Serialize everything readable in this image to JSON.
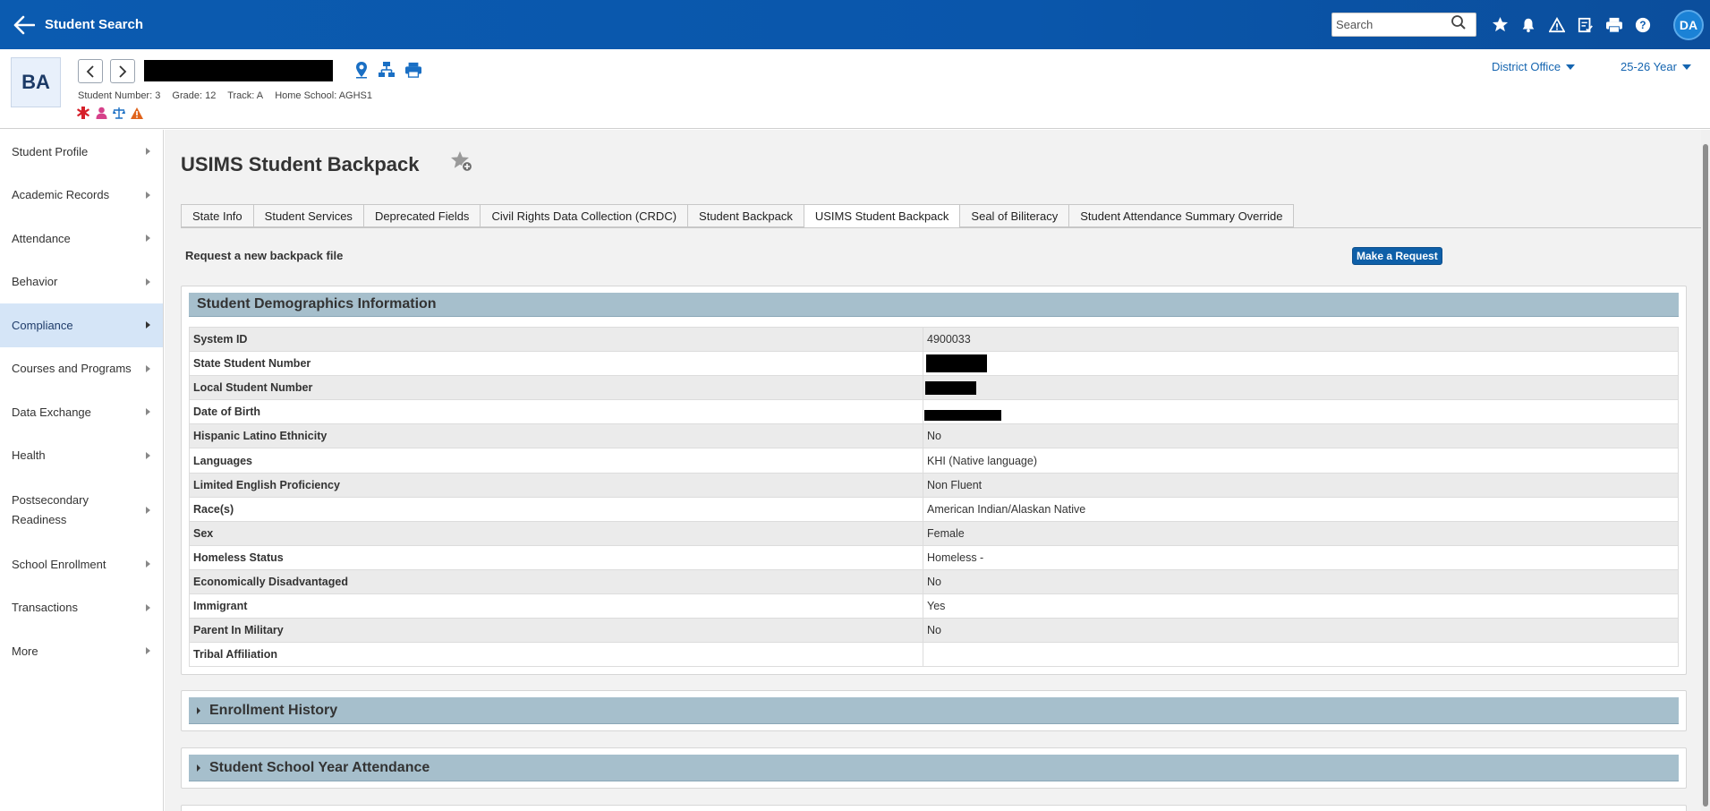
{
  "app": {
    "title": "Student Search"
  },
  "topbar": {
    "search_placeholder": "Search",
    "user_initials": "DA"
  },
  "student": {
    "initials": "BA",
    "number_label": "Student Number: 3",
    "grade_label": "Grade: 12",
    "track_label": "Track: A",
    "home_school_label": "Home School: AGHS1"
  },
  "context": {
    "office": "District Office",
    "year": "25-26 Year"
  },
  "sidebar": {
    "items": [
      {
        "label": "Student Profile"
      },
      {
        "label": "Academic Records"
      },
      {
        "label": "Attendance"
      },
      {
        "label": "Behavior"
      },
      {
        "label": "Compliance"
      },
      {
        "label": "Courses and Programs"
      },
      {
        "label": "Data Exchange"
      },
      {
        "label": "Health"
      },
      {
        "label": "Postsecondary Readiness"
      },
      {
        "label": "School Enrollment"
      },
      {
        "label": "Transactions"
      },
      {
        "label": "More"
      }
    ]
  },
  "page": {
    "title": "USIMS Student Backpack"
  },
  "tabs": [
    {
      "label": "State Info"
    },
    {
      "label": "Student Services"
    },
    {
      "label": "Deprecated Fields"
    },
    {
      "label": "Civil Rights Data Collection (CRDC)"
    },
    {
      "label": "Student Backpack"
    },
    {
      "label": "USIMS Student Backpack"
    },
    {
      "label": "Seal of Biliteracy"
    },
    {
      "label": "Student Attendance Summary Override"
    }
  ],
  "request": {
    "label": "Request a new backpack file",
    "button": "Make a Request"
  },
  "demographics": {
    "title": "Student Demographics Information",
    "rows": [
      {
        "key": "System ID",
        "value": "4900033"
      },
      {
        "key": "State Student Number",
        "value": ""
      },
      {
        "key": "Local Student Number",
        "value": ""
      },
      {
        "key": "Date of Birth",
        "value": ""
      },
      {
        "key": "Hispanic Latino Ethnicity",
        "value": "No"
      },
      {
        "key": "Languages",
        "value": "KHI (Native language)"
      },
      {
        "key": "Limited English Proficiency",
        "value": "Non Fluent"
      },
      {
        "key": "Race(s)",
        "value": "American Indian/Alaskan Native"
      },
      {
        "key": "Sex",
        "value": "Female"
      },
      {
        "key": "Homeless Status",
        "value": "Homeless -"
      },
      {
        "key": "Economically Disadvantaged",
        "value": "No"
      },
      {
        "key": "Immigrant",
        "value": "Yes"
      },
      {
        "key": "Parent In Military",
        "value": "No"
      },
      {
        "key": "Tribal Affiliation",
        "value": ""
      }
    ]
  },
  "sections": [
    {
      "title": "Enrollment History"
    },
    {
      "title": "Student School Year Attendance"
    }
  ],
  "colors": {
    "topbar": "#0b5bb0",
    "active_nav": "#d5e5f7",
    "panel_header": "#a6bfcc",
    "button": "#0e5fa8"
  }
}
